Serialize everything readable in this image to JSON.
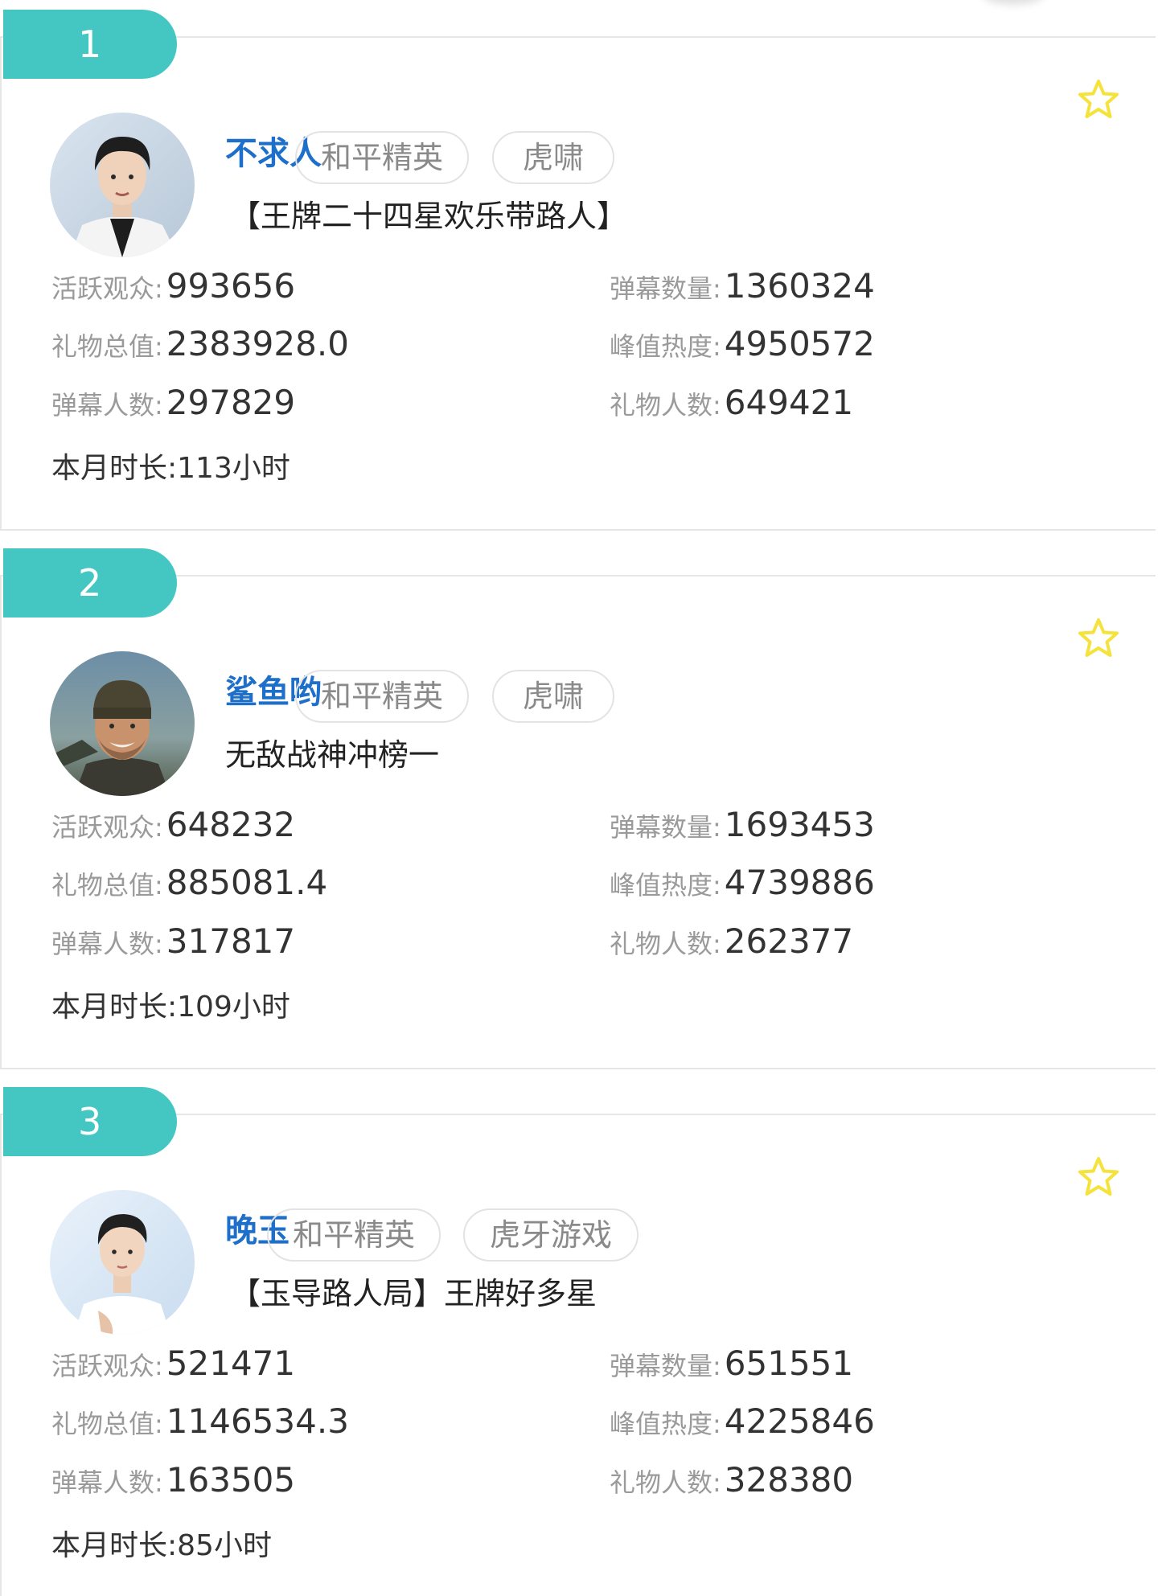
{
  "accent_color": "#44c7c3",
  "name_color": "#1e6fc9",
  "star_color": "#f5e23a",
  "labels": {
    "active_viewers": "活跃观众:",
    "danmu_count": "弹幕数量:",
    "gift_total": "礼物总值:",
    "peak_heat": "峰值热度:",
    "danmu_users": "弹幕人数:",
    "gift_users": "礼物人数:",
    "month_duration": "本月时长:"
  },
  "streamers": [
    {
      "rank": "1",
      "name": "不求人",
      "game_tag": "和平精英",
      "platform_tag": "虎啸",
      "slogan": "【王牌二十四星欢乐带路人】",
      "active_viewers": "993656",
      "danmu_count": "1360324",
      "gift_total": "2383928.0",
      "peak_heat": "4950572",
      "danmu_users": "297829",
      "gift_users": "649421",
      "month_duration": "113小时",
      "favorite_icon": "star-outline-icon"
    },
    {
      "rank": "2",
      "name": "鲨鱼哟",
      "game_tag": "和平精英",
      "platform_tag": "虎啸",
      "slogan": "无敌战神冲榜一",
      "active_viewers": "648232",
      "danmu_count": "1693453",
      "gift_total": "885081.4",
      "peak_heat": "4739886",
      "danmu_users": "317817",
      "gift_users": "262377",
      "month_duration": "109小时",
      "favorite_icon": "star-outline-icon"
    },
    {
      "rank": "3",
      "name": "晚玉",
      "game_tag": "和平精英",
      "platform_tag": "虎牙游戏",
      "slogan": "【玉导路人局】王牌好多星",
      "active_viewers": "521471",
      "danmu_count": "651551",
      "gift_total": "1146534.3",
      "peak_heat": "4225846",
      "danmu_users": "163505",
      "gift_users": "328380",
      "month_duration": "85小时",
      "favorite_icon": "star-outline-icon"
    }
  ]
}
